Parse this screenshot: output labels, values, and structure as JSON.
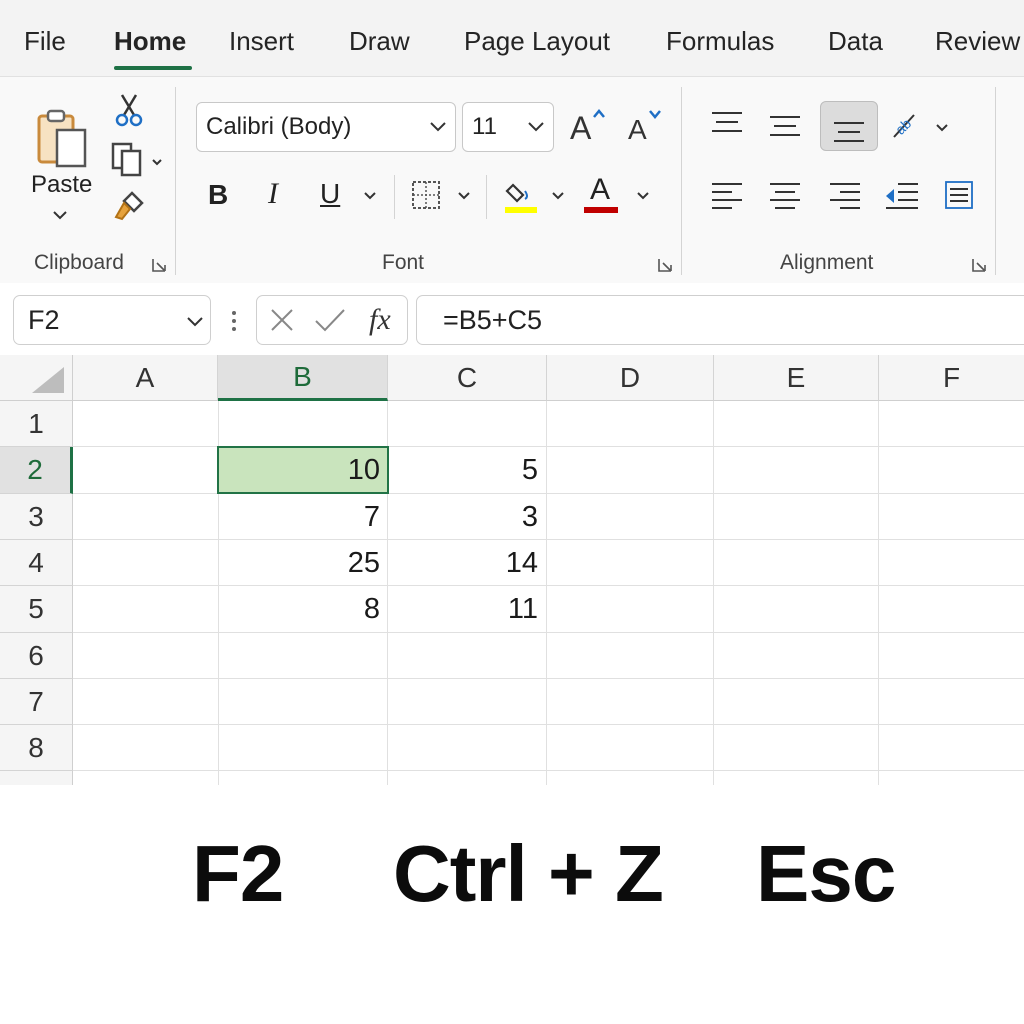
{
  "menu": {
    "tabs": [
      {
        "label": "File"
      },
      {
        "label": "Home"
      },
      {
        "label": "Insert"
      },
      {
        "label": "Draw"
      },
      {
        "label": "Page Layout"
      },
      {
        "label": "Formulas"
      },
      {
        "label": "Data"
      },
      {
        "label": "Review"
      }
    ],
    "active_tab": "Home",
    "accent_color": "#1e7145"
  },
  "ribbon": {
    "clipboard": {
      "label": "Clipboard",
      "paste_label": "Paste"
    },
    "font": {
      "label": "Font",
      "font_name": "Calibri (Body)",
      "font_size": "11",
      "bold": "B",
      "italic": "I",
      "underline": "U",
      "font_color_glyph": "A",
      "highlight_color": "#ffff00",
      "font_color": "#c00000"
    },
    "alignment": {
      "label": "Alignment"
    }
  },
  "formula_bar": {
    "name_box": "F2",
    "formula": "=B5+C5",
    "fx_label": "fx"
  },
  "grid": {
    "columns": [
      "A",
      "B",
      "C",
      "D",
      "E",
      "F"
    ],
    "rows": [
      "1",
      "2",
      "3",
      "4",
      "5",
      "6",
      "7",
      "8"
    ],
    "selected_column": "B",
    "selected_row": "2",
    "cells": {
      "B2": "10",
      "C2": "5",
      "B3": "7",
      "C3": "3",
      "B4": "25",
      "C4": "14",
      "B5": "8",
      "C5": "11"
    }
  },
  "shortcuts": [
    "F2",
    "Ctrl + Z",
    "Esc"
  ]
}
